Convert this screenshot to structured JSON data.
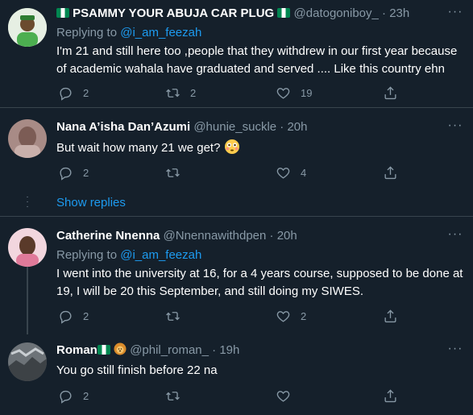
{
  "tweets": [
    {
      "name": "PSAMMY YOUR ABUJA CAR PLUG",
      "handle": "@datogoniboy_",
      "time": "23h",
      "replying_label": "Replying to",
      "replying_to": "@i_am_feezah",
      "text": "I'm 21 and still here too ,people that they withdrew in our first year because of academic wahala have graduated and served .... Like this country ehn",
      "replies": "2",
      "retweets": "2",
      "likes": "19"
    },
    {
      "name": "Nana A’isha Dan’Azumi",
      "handle": "@hunie_suckle",
      "time": "20h",
      "text": "But wait how many 21 we get?",
      "replies": "2",
      "retweets": "",
      "likes": "4"
    },
    {
      "name": "Catherine Nnenna",
      "handle": "@Nnennawithdpen",
      "time": "20h",
      "replying_label": "Replying to",
      "replying_to": "@i_am_feezah",
      "text": "I went into the university at 16, for a 4 years course, supposed to be done at 19, I will be 20 this September, and still doing my SIWES.",
      "replies": "2",
      "retweets": "",
      "likes": "2"
    },
    {
      "name": "Roman",
      "handle": "@phil_roman_",
      "time": "19h",
      "text": "You go still finish before 22 na",
      "replies": "2",
      "retweets": "",
      "likes": ""
    }
  ],
  "show_replies_label": "Show replies",
  "separator": "·",
  "colors": {
    "background": "#15202b",
    "text_secondary": "#8899a6",
    "link": "#1d9bf0",
    "divider": "#38444d"
  },
  "icons": [
    "reply-icon",
    "retweet-icon",
    "like-icon",
    "share-icon",
    "more-icon",
    "nigeria-flag-icon",
    "lion-icon",
    "flushed-face-icon"
  ]
}
